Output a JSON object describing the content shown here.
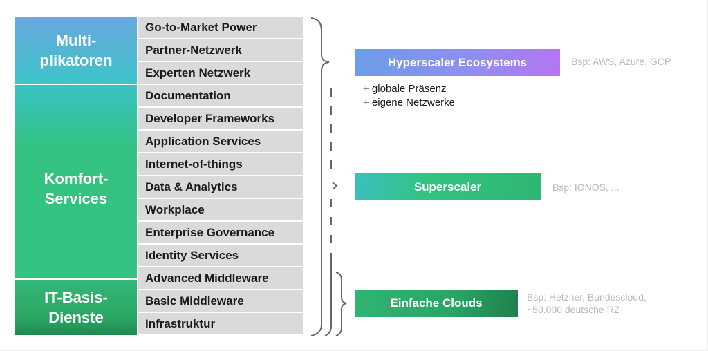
{
  "categories": [
    {
      "id": "multi",
      "line1": "Multi-",
      "line2": "plikatoren",
      "color_top": "#6aa6e0",
      "color_bottom": "#3cc4c8"
    },
    {
      "id": "komfort",
      "line1": "Komfort-",
      "line2": "Services",
      "color_top": "#38c3c3",
      "color_bottom": "#33c27f"
    },
    {
      "id": "basis",
      "line1": "IT-Basis-",
      "line2": "Dienste",
      "color_top": "#33b878",
      "color_bottom": "#1f8a50"
    }
  ],
  "services": [
    "Go-to-Market Power",
    "Partner-Netzwerk",
    "Experten Netzwerk",
    "Documentation",
    "Developer Frameworks",
    "Application Services",
    "Internet-of-things",
    "Data & Analytics",
    "Workplace",
    "Enterprise Governance",
    "Identity Services",
    "Advanced Middleware",
    "Basic Middleware",
    "Infrastruktur"
  ],
  "tiers": {
    "hyperscaler": {
      "label": "Hyperscaler Ecosystems",
      "example": "Bsp: AWS, Azure, GCP",
      "benefits": [
        "+ globale Präsenz",
        "+ eigene Netzwerke"
      ],
      "color_start": "#6a9ee6",
      "color_end": "#b575f3"
    },
    "superscaler": {
      "label": "Superscaler",
      "example": "Bsp: IONOS, ...",
      "color_start": "#3cc0bf",
      "color_end": "#2fb574"
    },
    "clouds": {
      "label": "Einfache Clouds",
      "example_line1": "Bsp: Hetzner, Bundescloud,",
      "example_line2": "~50.000 deutsche RZ",
      "color_start": "#2fb573",
      "color_end": "#1f7f4c"
    }
  }
}
